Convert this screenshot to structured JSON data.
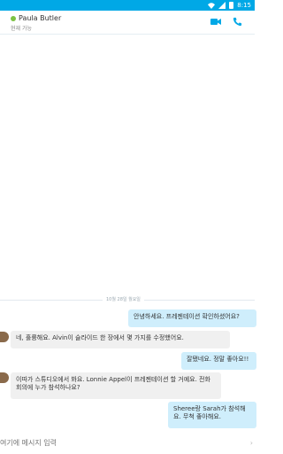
{
  "statusbar": {
    "time": "8:15"
  },
  "header": {
    "contact_name": "Paula Butler",
    "status": "현재 가능"
  },
  "conversation": {
    "date_label": "10월 28일 월요일",
    "messages": [
      {
        "direction": "out",
        "text": "안녕하세요. 프레젠테이션 확인하셨어요?"
      },
      {
        "direction": "in",
        "text": "네, 훌륭해요. Alvin이 슬라이드 한 장에서 몇 가지를 수정했어요."
      },
      {
        "direction": "out",
        "text": "잘됐네요. 정말 좋아요!!"
      },
      {
        "direction": "in",
        "text": "이따가 스튜디오에서 봐요. Lonnie Appel이 프레젠테이션 할 거예요. 전화 회의에 누가 참석하나요?"
      },
      {
        "direction": "out",
        "text": "Sheree랑 Sarah가 참석해요. 무척 좋아해요."
      }
    ]
  },
  "composer": {
    "placeholder": "여기에 메시지 입력",
    "send_label": "›"
  },
  "colors": {
    "accent": "#00a8e6",
    "outgoing_bubble": "#cfeefc",
    "incoming_bubble": "#f0f0f0",
    "presence": "#7cc242"
  }
}
